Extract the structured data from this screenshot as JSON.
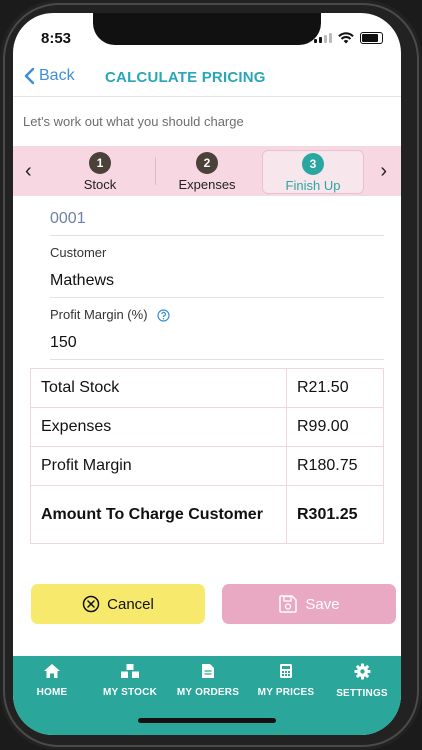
{
  "status": {
    "time": "8:53"
  },
  "nav": {
    "back_label": "Back",
    "title": "CALCULATE PRICING"
  },
  "subtitle": "Let's work out what you should charge",
  "steps": [
    {
      "number": "1",
      "label": "Stock"
    },
    {
      "number": "2",
      "label": "Expenses"
    },
    {
      "number": "3",
      "label": "Finish Up"
    }
  ],
  "form": {
    "reference": "0001",
    "customer_label": "Customer",
    "customer_value": "Mathews",
    "margin_label": "Profit Margin (%)",
    "margin_value": "150"
  },
  "summary": [
    {
      "label": "Total Stock",
      "value": "R21.50"
    },
    {
      "label": "Expenses",
      "value": "R99.00"
    },
    {
      "label": "Profit Margin",
      "value": "R180.75"
    },
    {
      "label": "Amount To Charge Customer",
      "value": "R301.25"
    }
  ],
  "buttons": {
    "cancel": "Cancel",
    "save": "Save"
  },
  "tabs": [
    {
      "label": "HOME",
      "icon": "home-icon"
    },
    {
      "label": "MY STOCK",
      "icon": "boxes-icon"
    },
    {
      "label": "MY ORDERS",
      "icon": "document-icon"
    },
    {
      "label": "MY PRICES",
      "icon": "calculator-icon"
    },
    {
      "label": "SETTINGS",
      "icon": "gear-icon"
    }
  ],
  "colors": {
    "accent_teal": "#29a7b7",
    "tabbar": "#2aa79a",
    "stepper_bg": "#f6d7e2",
    "cancel_button": "#f7e96b",
    "save_button": "#eaa9c3",
    "back_link": "#3b8fd6"
  }
}
